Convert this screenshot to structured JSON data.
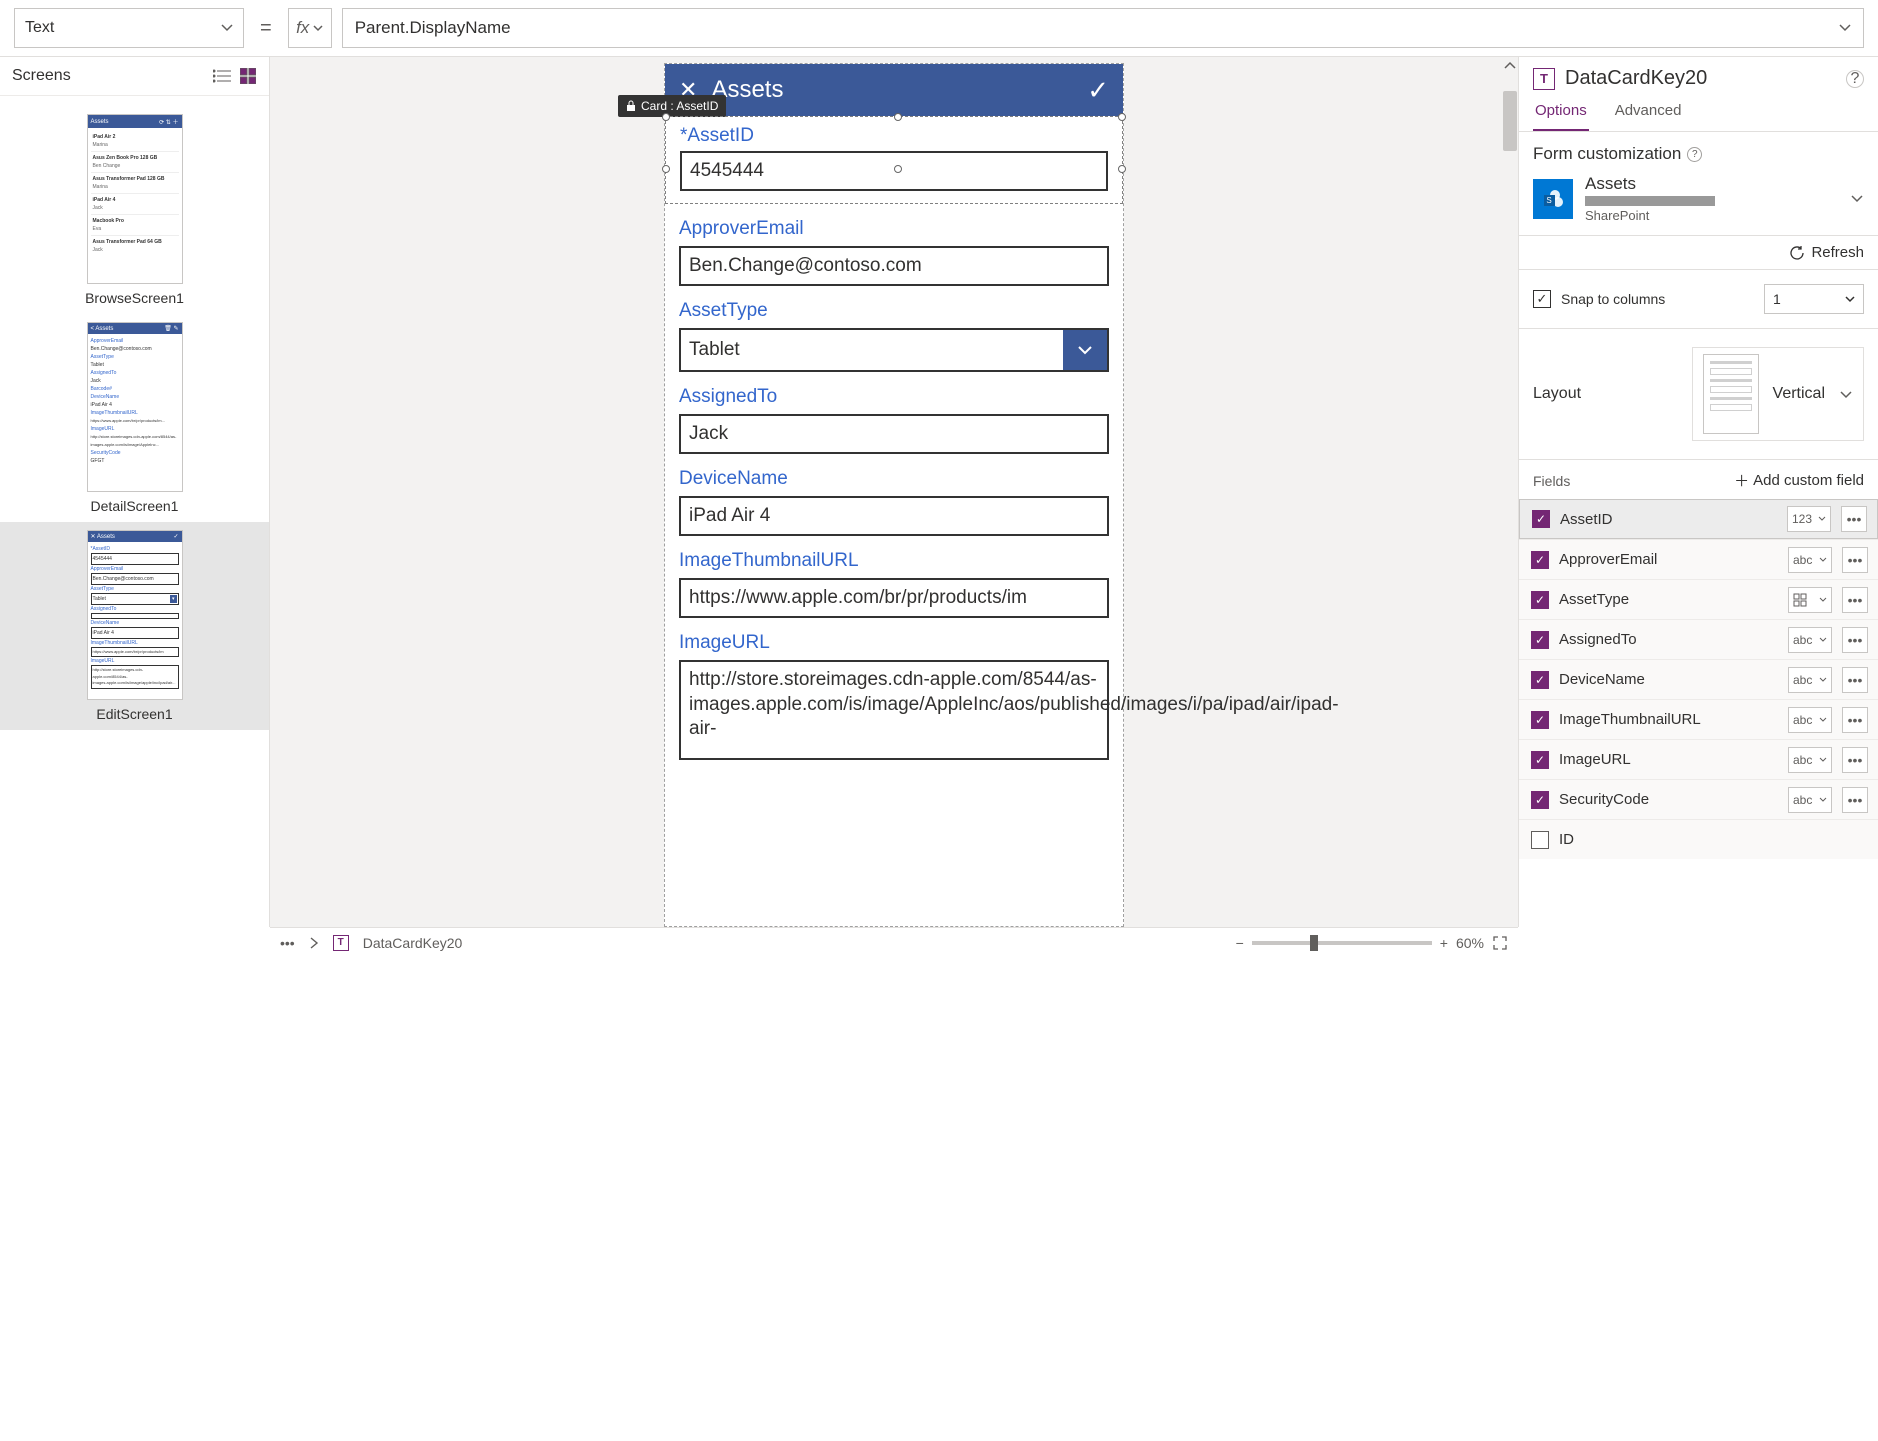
{
  "formulaBar": {
    "property": "Text",
    "equals": "=",
    "fx": "fx",
    "expression": "Parent.DisplayName"
  },
  "screensPanel": {
    "title": "Screens",
    "screens": [
      {
        "name": "BrowseScreen1",
        "header": "Assets"
      },
      {
        "name": "DetailScreen1",
        "header": "Assets"
      },
      {
        "name": "EditScreen1",
        "header": "Assets"
      }
    ]
  },
  "tooltip": "Card : AssetID",
  "form": {
    "title": "Assets",
    "cards": {
      "assetId": {
        "label": "AssetID",
        "required": true,
        "value": "4545444"
      },
      "approver": {
        "label": "ApproverEmail",
        "value": "Ben.Change@contoso.com"
      },
      "assetType": {
        "label": "AssetType",
        "value": "Tablet"
      },
      "assigned": {
        "label": "AssignedTo",
        "value": "Jack"
      },
      "device": {
        "label": "DeviceName",
        "value": "iPad Air 4"
      },
      "thumbUrl": {
        "label": "ImageThumbnailURL",
        "value": "https://www.apple.com/br/pr/products/im"
      },
      "imageUrl": {
        "label": "ImageURL",
        "value": "http://store.storeimages.cdn-apple.com/8544/as-images.apple.com/is/image/AppleInc/aos/published/images/i/pa/ipad/air/ipad-air-"
      }
    }
  },
  "rightPanel": {
    "selectedControl": "DataCardKey20",
    "tabs": {
      "options": "Options",
      "advanced": "Advanced"
    },
    "formCustomization": "Form customization",
    "dataSource": {
      "name": "Assets",
      "connector": "SharePoint"
    },
    "refresh": "Refresh",
    "snapToColumns": "Snap to columns",
    "columns": "1",
    "layoutLabel": "Layout",
    "layoutValue": "Vertical",
    "fieldsLabel": "Fields",
    "addCustomField": "Add custom field",
    "fields": [
      {
        "name": "AssetID",
        "type": "123",
        "checked": true,
        "selected": true
      },
      {
        "name": "ApproverEmail",
        "type": "abc",
        "checked": true
      },
      {
        "name": "AssetType",
        "type": "grid",
        "checked": true
      },
      {
        "name": "AssignedTo",
        "type": "abc",
        "checked": true
      },
      {
        "name": "DeviceName",
        "type": "abc",
        "checked": true
      },
      {
        "name": "ImageThumbnailURL",
        "type": "abc",
        "checked": true
      },
      {
        "name": "ImageURL",
        "type": "abc",
        "checked": true
      },
      {
        "name": "SecurityCode",
        "type": "abc",
        "checked": true
      },
      {
        "name": "ID",
        "type": "",
        "checked": false
      }
    ]
  },
  "statusBar": {
    "breadcrumb": "DataCardKey20",
    "zoom": "60%"
  }
}
